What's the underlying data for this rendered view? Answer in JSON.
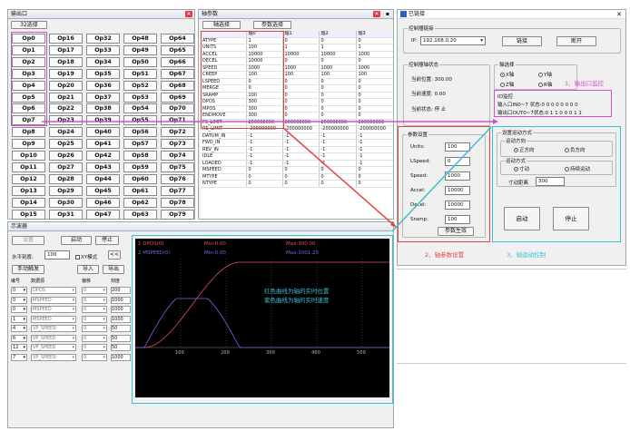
{
  "io_panel": {
    "title": "输出口",
    "tab": "32选择",
    "columns": [
      [
        "Op0",
        "Op1",
        "Op2",
        "Op3",
        "Op4",
        "Op5",
        "Op6",
        "Op7",
        "Op8",
        "Op9",
        "Op10",
        "Op11",
        "Op12",
        "Op13",
        "Op14",
        "Op15"
      ],
      [
        "Op16",
        "Op17",
        "Op18",
        "Op19",
        "Op20",
        "Op21",
        "Op22",
        "Op23",
        "Op24",
        "Op25",
        "Op26",
        "Op27",
        "Op28",
        "Op29",
        "Op30",
        "Op31"
      ],
      [
        "Op32",
        "Op33",
        "Op34",
        "Op35",
        "Op36",
        "Op37",
        "Op38",
        "Op39",
        "Op40",
        "Op41",
        "Op42",
        "Op43",
        "Op44",
        "Op45",
        "Op46",
        "Op47"
      ],
      [
        "Op48",
        "Op49",
        "Op50",
        "Op51",
        "Op52",
        "Op53",
        "Op54",
        "Op55",
        "Op56",
        "Op57",
        "Op58",
        "Op59",
        "Op60",
        "Op61",
        "Op62",
        "Op63"
      ],
      [
        "Op64",
        "Op65",
        "Op66",
        "Op67",
        "Op68",
        "Op69",
        "Op70",
        "Op71",
        "Op72",
        "Op73",
        "Op74",
        "Op75",
        "Op76",
        "Op77",
        "Op78",
        "Op79"
      ]
    ]
  },
  "axis_panel": {
    "title": "轴参数",
    "tabs": [
      "轴选择",
      "参数选择"
    ],
    "headers": [
      "",
      "轴0",
      "轴1",
      "轴2",
      "轴3"
    ],
    "rows": [
      [
        "ATYPE",
        "1",
        "0",
        "0",
        "0"
      ],
      [
        "UNITS",
        "100",
        "1",
        "1",
        "1"
      ],
      [
        "ACCEL",
        "10000",
        "10000",
        "10000",
        "1000"
      ],
      [
        "DECEL",
        "10000",
        "0",
        "0",
        "0"
      ],
      [
        "SPEED",
        "1000",
        "1000",
        "1000",
        "1000"
      ],
      [
        "CREEP",
        "100",
        "100",
        "100",
        "100"
      ],
      [
        "LSPEED",
        "0",
        "0",
        "0",
        "0"
      ],
      [
        "MERGE",
        "0",
        "0",
        "0",
        "0"
      ],
      [
        "SRAMP",
        "100",
        "0",
        "0",
        "0"
      ],
      [
        "DPOS",
        "300",
        "0",
        "0",
        "0"
      ],
      [
        "MPOS",
        "300",
        "0",
        "0",
        "0"
      ],
      [
        "ENDMOVE",
        "300",
        "0",
        "0",
        "0"
      ],
      [
        "FS_LIMIT",
        "200000000",
        "200000000",
        "200000000",
        "200000000"
      ],
      [
        "RS_LIMIT",
        "-200000000",
        "-200000000",
        "-200000000",
        "-200000000"
      ],
      [
        "DATUM_IN",
        "-1",
        "-1",
        "-1",
        "-1"
      ],
      [
        "FWD_IN",
        "-1",
        "-1",
        "-1",
        "-1"
      ],
      [
        "REV_IN",
        "-1",
        "-1",
        "-1",
        "-1"
      ],
      [
        "IDLE",
        "-1",
        "-1",
        "-1",
        "-1"
      ],
      [
        "LOADED",
        "-1",
        "-1",
        "-1",
        "-1"
      ],
      [
        "MSPEED",
        "0",
        "0",
        "0",
        "0"
      ],
      [
        "MTYPE",
        "0",
        "0",
        "0",
        "0"
      ],
      [
        "NTYPE",
        "0",
        "0",
        "0",
        "0"
      ]
    ]
  },
  "conn_panel": {
    "title": "已链接",
    "group_controller": "控制器链接",
    "ip_label": "IP:",
    "ip_value": "192.168.0.20",
    "link_btn": "链接",
    "disconnect_btn": "断开",
    "status_group": "控制器轴状态",
    "pos_label": "当前位置: 300.00",
    "speed_label": "当前速度: 0.00",
    "state_label": "当前状态: 停 止",
    "axis_group": "轴选择",
    "axes": [
      "X轴",
      "Y轴",
      "Z轴",
      "R轴"
    ],
    "io_title": "IO监控",
    "in_label": "输入口IN0~7 状态:0 0 0 0 0 0 0 0",
    "out_label": "输出口OUT0~7状态:0 1 1 0 0 0 1 1",
    "param_group": "参数设置",
    "params": [
      {
        "label": "Units:",
        "value": "100"
      },
      {
        "label": "LSpeed:",
        "value": "0"
      },
      {
        "label": "Speed:",
        "value": "1000"
      },
      {
        "label": "Accel:",
        "value": "10000"
      },
      {
        "label": "Decel:",
        "value": "10000"
      },
      {
        "label": "Sramp:",
        "value": "100"
      }
    ],
    "apply_btn": "参数生效",
    "motion_group": "设置运动方式",
    "dir_group": "运动方向",
    "dir_pos": "正方向",
    "dir_neg": "负方向",
    "mode_group": "运动方式",
    "mode_jog": "寸动",
    "mode_cont": "持续运动",
    "dist_label": "寸动距离",
    "dist_value": "300",
    "start_btn": "启动",
    "stop_btn": "停止"
  },
  "annotations": {
    "a1": "1、输出口监控",
    "a2": "2、轴参数设置",
    "a3": "3、轴运动控制",
    "note_red": "红色曲线为轴的实时位置",
    "note_purple": "紫色曲线为轴的实时速度"
  },
  "scope_panel": {
    "title": "示波器",
    "set_btn": "设置",
    "start_btn": "启动",
    "stop_btn": "停止",
    "hscale_label": "水平刻度:",
    "hscale_value": "100",
    "xy_label": "XY模式",
    "prev_btn": "<<",
    "trigger_btn": "手动触发",
    "import_btn": "导入",
    "export_btn": "导出",
    "headers": [
      "编号",
      "数据源",
      "偏移",
      "刻度"
    ],
    "rows": [
      [
        "0",
        "DPOS",
        "0",
        "200"
      ],
      [
        "0",
        "MSPEED",
        "0",
        "1000"
      ],
      [
        "0",
        "MSPEED",
        "0",
        "1000"
      ],
      [
        "1",
        "MSPEED",
        "0",
        "1000"
      ],
      [
        "4",
        "VP_SPEED",
        "0",
        "50"
      ],
      [
        "6",
        "VP_SPEED",
        "0",
        "50"
      ],
      [
        "12",
        "VP_SPEED",
        "0",
        "50"
      ],
      [
        "7",
        "VP_SPEED",
        "0",
        "1000"
      ]
    ],
    "trace1_label": "1 DPOS(0)",
    "trace1_min": "Min:0.00",
    "trace1_max": "Max:300.00",
    "trace2_label": "2 MSPEED(0)",
    "trace2_min": "Min:0.00",
    "trace2_max": "Max:1001.25",
    "xticks": [
      "100",
      "200",
      "300",
      "400",
      "500"
    ],
    "trace1_color": "#e0506a",
    "trace2_color": "#7a66e0"
  }
}
